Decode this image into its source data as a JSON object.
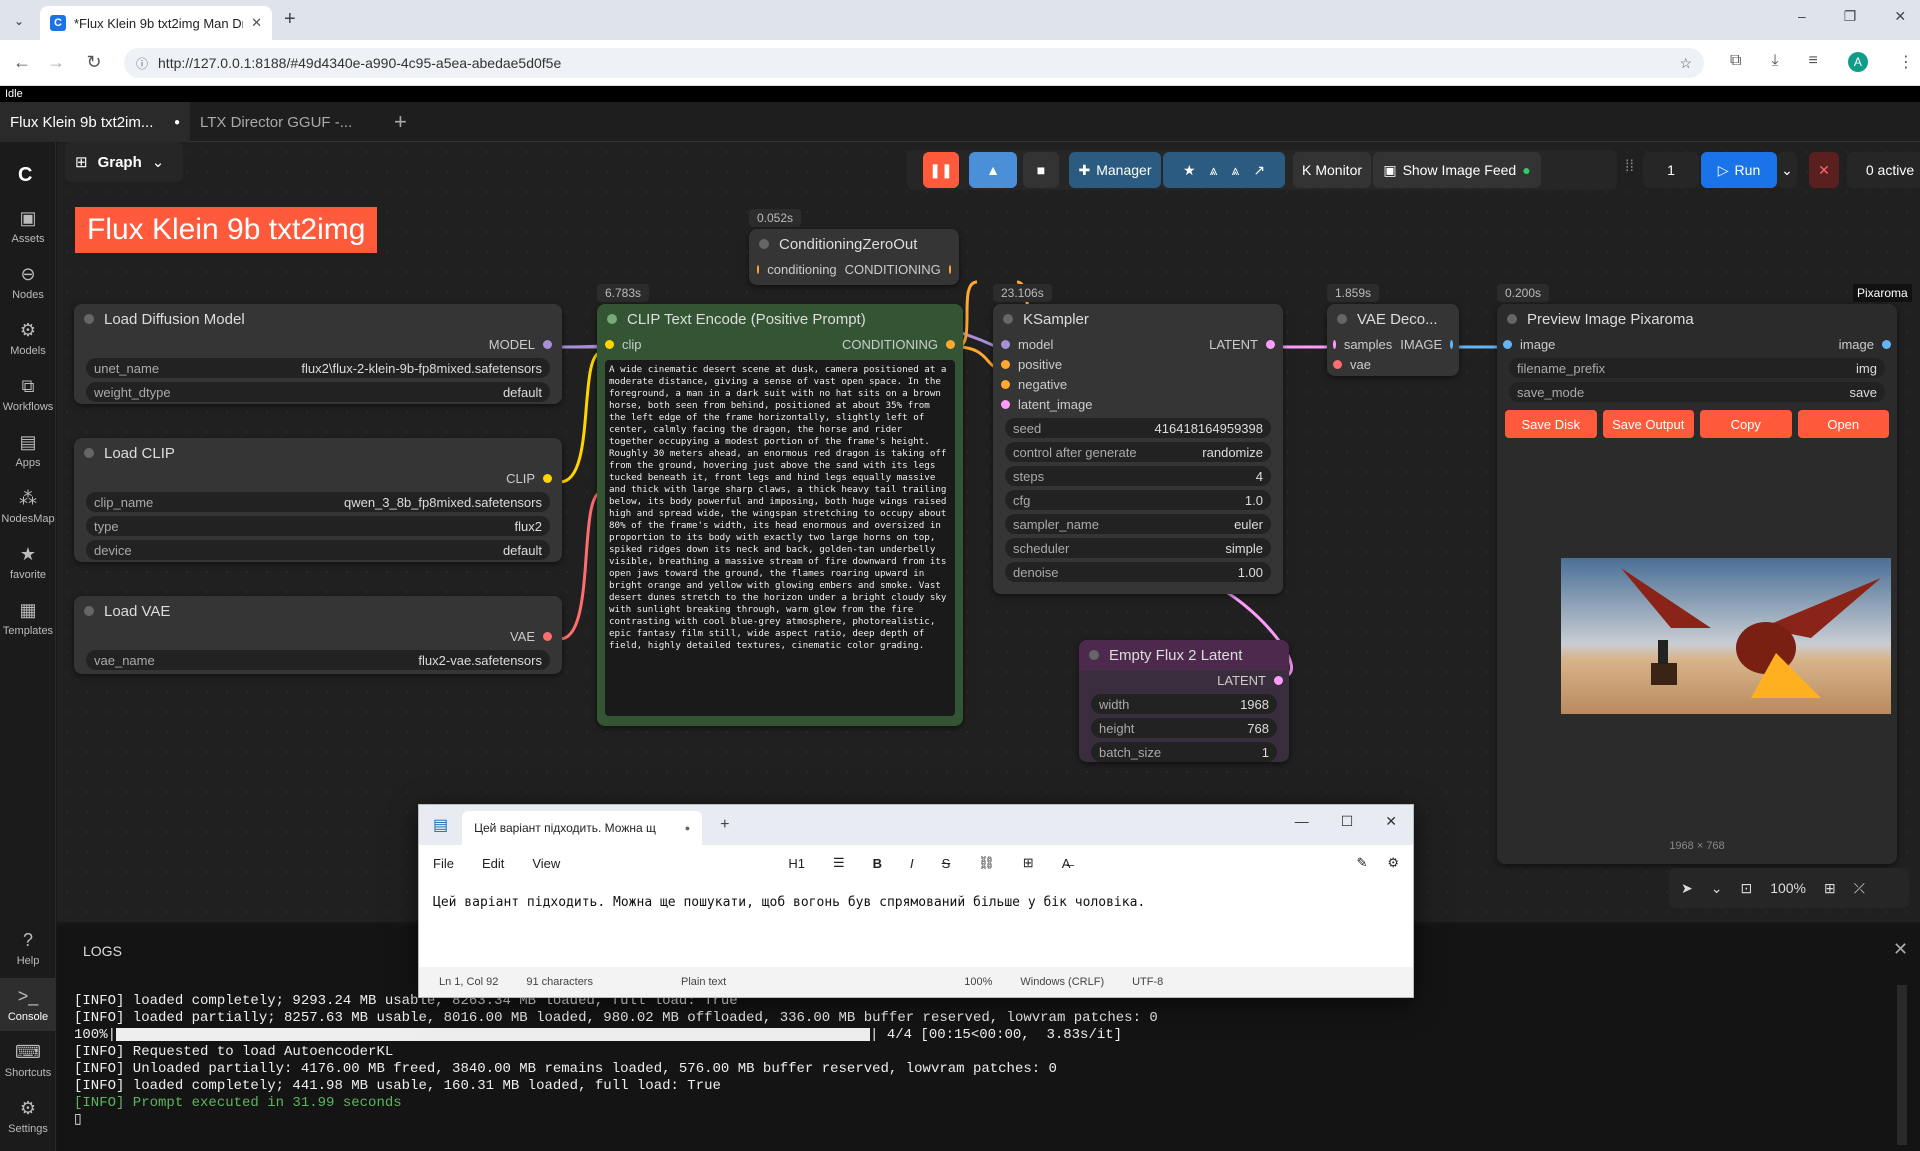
{
  "browser": {
    "tab_title": "*Flux Klein 9b txt2img Man Dra",
    "url": "http://127.0.0.1:8188/#49d4340e-a990-4c95-a5ea-abedae5d0f5e",
    "profile": "A"
  },
  "status": "Idle",
  "workflow_tabs": [
    {
      "label": "Flux Klein 9b txt2im...",
      "active": true
    },
    {
      "label": "LTX Director GGUF -...",
      "active": false
    }
  ],
  "sidebar": [
    {
      "icon": "assets-icon",
      "label": "Assets"
    },
    {
      "icon": "nodes-icon",
      "label": "Nodes"
    },
    {
      "icon": "models-icon",
      "label": "Models"
    },
    {
      "icon": "workflows-icon",
      "label": "Workflows"
    },
    {
      "icon": "apps-icon",
      "label": "Apps"
    },
    {
      "icon": "nodesmap-icon",
      "label": "NodesMap"
    },
    {
      "icon": "star-icon",
      "label": "favorite"
    },
    {
      "icon": "templates-icon",
      "label": "Templates"
    },
    {
      "icon": "help-icon",
      "label": "Help"
    },
    {
      "icon": "console-icon",
      "label": "Console"
    },
    {
      "icon": "keyboard-icon",
      "label": "Shortcuts"
    },
    {
      "icon": "gear-icon",
      "label": "Settings"
    }
  ],
  "graph_label": "Graph",
  "title_note": "Flux Klein 9b txt2img",
  "toolbar": {
    "manager": "Manager",
    "monitor": "Monitor",
    "show_feed": "Show Image Feed",
    "queue_count": "1",
    "run": "Run",
    "active": "0 active"
  },
  "nodes": {
    "load_diffusion": {
      "title": "Load Diffusion Model",
      "out": "MODEL",
      "w": [
        {
          "k": "unet_name",
          "v": "flux2\\flux-2-klein-9b-fp8mixed.safetensors"
        },
        {
          "k": "weight_dtype",
          "v": "default"
        }
      ]
    },
    "load_clip": {
      "title": "Load CLIP",
      "out": "CLIP",
      "w": [
        {
          "k": "clip_name",
          "v": "qwen_3_8b_fp8mixed.safetensors"
        },
        {
          "k": "type",
          "v": "flux2"
        },
        {
          "k": "device",
          "v": "default"
        }
      ]
    },
    "load_vae": {
      "title": "Load VAE",
      "out": "VAE",
      "w": [
        {
          "k": "vae_name",
          "v": "flux2-vae.safetensors"
        }
      ]
    },
    "clip_encode": {
      "title": "CLIP Text Encode (Positive Prompt)",
      "timer": "6.783s",
      "in": "clip",
      "out": "CONDITIONING",
      "text": "A wide cinematic desert scene at dusk, camera positioned at a moderate distance, giving a sense of vast open space. In the foreground, a man in a dark suit with no hat sits on a brown horse, both seen from behind, positioned at about 35% from the left edge of the frame horizontally, slightly left of center, calmly facing the dragon, the horse and rider together occupying a modest portion of the frame's height. Roughly 30 meters ahead, an enormous red dragon is taking off from the ground, hovering just above the sand with its legs tucked beneath it, front legs and hind legs equally massive and thick with large sharp claws, a thick heavy tail trailing below, its body powerful and imposing, both huge wings raised high and spread wide, the wingspan stretching to occupy about 80% of the frame's width, its head enormous and oversized in proportion to its body with exactly two large horns on top, spiked ridges down its neck and back, golden-tan underbelly visible, breathing a massive stream of fire downward from its open jaws toward the ground, the flames roaring upward in bright orange and yellow with glowing embers and smoke. Vast desert dunes stretch to the horizon under a bright cloudy sky with sunlight breaking through, warm glow from the fire contrasting with cool blue-grey atmosphere, photorealistic, epic fantasy film still, wide aspect ratio, deep depth of field, highly detailed textures, cinematic color grading."
    },
    "cond_zero": {
      "title": "ConditioningZeroOut",
      "timer": "0.052s",
      "in": "conditioning",
      "out": "CONDITIONING"
    },
    "ksampler": {
      "title": "KSampler",
      "timer": "23.106s",
      "ins": [
        "model",
        "positive",
        "negative",
        "latent_image"
      ],
      "out": "LATENT",
      "w": [
        {
          "k": "seed",
          "v": "416418164959398"
        },
        {
          "k": "control after generate",
          "v": "randomize"
        },
        {
          "k": "steps",
          "v": "4"
        },
        {
          "k": "cfg",
          "v": "1.0"
        },
        {
          "k": "sampler_name",
          "v": "euler"
        },
        {
          "k": "scheduler",
          "v": "simple"
        },
        {
          "k": "denoise",
          "v": "1.00"
        }
      ]
    },
    "vae_decode": {
      "title": "VAE Deco...",
      "timer": "1.859s",
      "ins": [
        "samples",
        "vae"
      ],
      "out": "IMAGE"
    },
    "preview": {
      "title": "Preview Image Pixaroma",
      "timer": "0.200s",
      "badge": "Pixaroma",
      "in": "image",
      "out": "image",
      "w": [
        {
          "k": "filename_prefix",
          "v": "img"
        },
        {
          "k": "save_mode",
          "v": "save"
        }
      ],
      "buttons": [
        "Save Disk",
        "Save Output",
        "Copy",
        "Open"
      ],
      "size": "1968 × 768"
    },
    "empty_latent": {
      "title": "Empty Flux 2 Latent",
      "out": "LATENT",
      "w": [
        {
          "k": "width",
          "v": "1968"
        },
        {
          "k": "height",
          "v": "768"
        },
        {
          "k": "batch_size",
          "v": "1"
        }
      ]
    }
  },
  "zoom": "100%",
  "notepad": {
    "tab": "Цей варіант підходить. Можна щ",
    "menu": [
      "File",
      "Edit",
      "View"
    ],
    "heading": "H1",
    "content": "Цей варіант підходить. Можна ще пошукати, щоб вогонь був спрямований більше у бік чоловіка.",
    "status": [
      "Ln 1, Col 92",
      "91 characters",
      "Plain text",
      "100%",
      "Windows (CRLF)",
      "UTF-8"
    ]
  },
  "logs": {
    "title": "LOGS",
    "lines": [
      "[INFO] loaded completely; 9293.24 MB usable, 8263.34 MB loaded, full load: True",
      "[INFO] loaded partially; 8257.63 MB usable, 8016.00 MB loaded, 980.02 MB offloaded, 336.00 MB buffer reserved, lowvram patches: 0",
      "[INFO] Requested to load AutoencoderKL",
      "[INFO] Unloaded partially: 4176.00 MB freed, 3840.00 MB remains loaded, 576.00 MB buffer reserved, lowvram patches: 0",
      "[INFO] loaded completely; 441.98 MB usable, 160.31 MB loaded, full load: True"
    ],
    "progress_prefix": "100%|",
    "progress_suffix": "| 4/4 [00:15<00:00,  3.83s/it]",
    "done": "[INFO] Prompt executed in 31.99 seconds"
  },
  "colors": {
    "accent": "#ff5a3c",
    "clip_green": "#335533",
    "latent_pink": "#ff9cf9",
    "image_blue": "#64b5f6"
  }
}
